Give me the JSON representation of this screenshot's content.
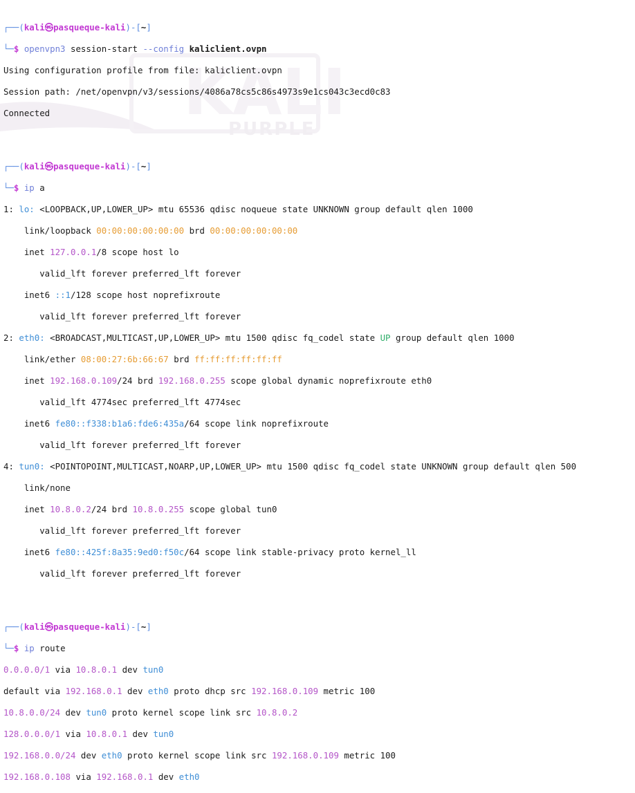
{
  "prompt": {
    "user": "kali",
    "host": "pasqueque-kali",
    "dir": "~"
  },
  "watermark": {
    "logo_text": "KALI",
    "sub_text": "PURPLE"
  },
  "block1": {
    "cmd": "openvpn3",
    "args": "session-start ",
    "flag": "--config",
    "file": "kaliclient.ovpn",
    "out1": "Using configuration profile from file: kaliclient.ovpn",
    "out2": "Session path: /net/openvpn/v3/sessions/4086a78cs5c86s4973s9e1cs043c3ecd0c83",
    "out3": "Connected"
  },
  "block2": {
    "cmd": "ip",
    "args": "a",
    "lines": {
      "l1a": "1: ",
      "l1b": "lo:",
      "l1c": " <LOOPBACK,UP,LOWER_UP> mtu 65536 qdisc noqueue state UNKNOWN group default qlen 1000",
      "l2a": "    link/loopback ",
      "l2b": "00:00:00:00:00:00",
      "l2c": " brd ",
      "l2d": "00:00:00:00:00:00",
      "l3a": "    inet ",
      "l3b": "127.0.0.1",
      "l3c": "/8 scope host lo",
      "l4": "       valid_lft forever preferred_lft forever",
      "l5a": "    inet6 ",
      "l5b": "::1",
      "l5c": "/128 scope host noprefixroute",
      "l6": "       valid_lft forever preferred_lft forever",
      "l7a": "2: ",
      "l7b": "eth0:",
      "l7c": " <BROADCAST,MULTICAST,UP,LOWER_UP> mtu 1500 qdisc fq_codel state ",
      "l7d": "UP",
      "l7e": " group default qlen 1000",
      "l8a": "    link/ether ",
      "l8b": "08:00:27:6b:66:67",
      "l8c": " brd ",
      "l8d": "ff:ff:ff:ff:ff:ff",
      "l9a": "    inet ",
      "l9b": "192.168.0.109",
      "l9c": "/24 brd ",
      "l9d": "192.168.0.255",
      "l9e": " scope global dynamic noprefixroute eth0",
      "l10": "       valid_lft 4774sec preferred_lft 4774sec",
      "l11a": "    inet6 ",
      "l11b": "fe80::f338:b1a6:fde6:435a",
      "l11c": "/64 scope link noprefixroute",
      "l12": "       valid_lft forever preferred_lft forever",
      "l13a": "4: ",
      "l13b": "tun0:",
      "l13c": " <POINTOPOINT,MULTICAST,NOARP,UP,LOWER_UP> mtu 1500 qdisc fq_codel state UNKNOWN group default qlen 500",
      "l14": "    link/none",
      "l15a": "    inet ",
      "l15b": "10.8.0.2",
      "l15c": "/24 brd ",
      "l15d": "10.8.0.255",
      "l15e": " scope global tun0",
      "l16": "       valid_lft forever preferred_lft forever",
      "l17a": "    inet6 ",
      "l17b": "fe80::425f:8a35:9ed0:f50c",
      "l17c": "/64 scope link stable-privacy proto kernel_ll",
      "l18": "       valid_lft forever preferred_lft forever"
    }
  },
  "block3": {
    "cmd": "ip",
    "args": "route",
    "r1a": "0.0.0.0/1",
    "r1b": " via ",
    "r1c": "10.8.0.1",
    "r1d": " dev ",
    "r1e": "tun0",
    "r2a": "default via ",
    "r2b": "192.168.0.1",
    "r2c": " dev ",
    "r2d": "eth0",
    "r2e": " proto dhcp src ",
    "r2f": "192.168.0.109",
    "r2g": " metric 100",
    "r3a": "10.8.0.0/24",
    "r3b": " dev ",
    "r3c": "tun0",
    "r3d": " proto kernel scope link src ",
    "r3e": "10.8.0.2",
    "r4a": "128.0.0.0/1",
    "r4b": " via ",
    "r4c": "10.8.0.1",
    "r4d": " dev ",
    "r4e": "tun0",
    "r5a": "192.168.0.0/24",
    "r5b": " dev ",
    "r5c": "eth0",
    "r5d": " proto kernel scope link src ",
    "r5e": "192.168.0.109",
    "r5f": " metric 100",
    "r6a": "192.168.0.108",
    "r6b": " via ",
    "r6c": "192.168.0.1",
    "r6d": " dev ",
    "r6e": "eth0"
  }
}
